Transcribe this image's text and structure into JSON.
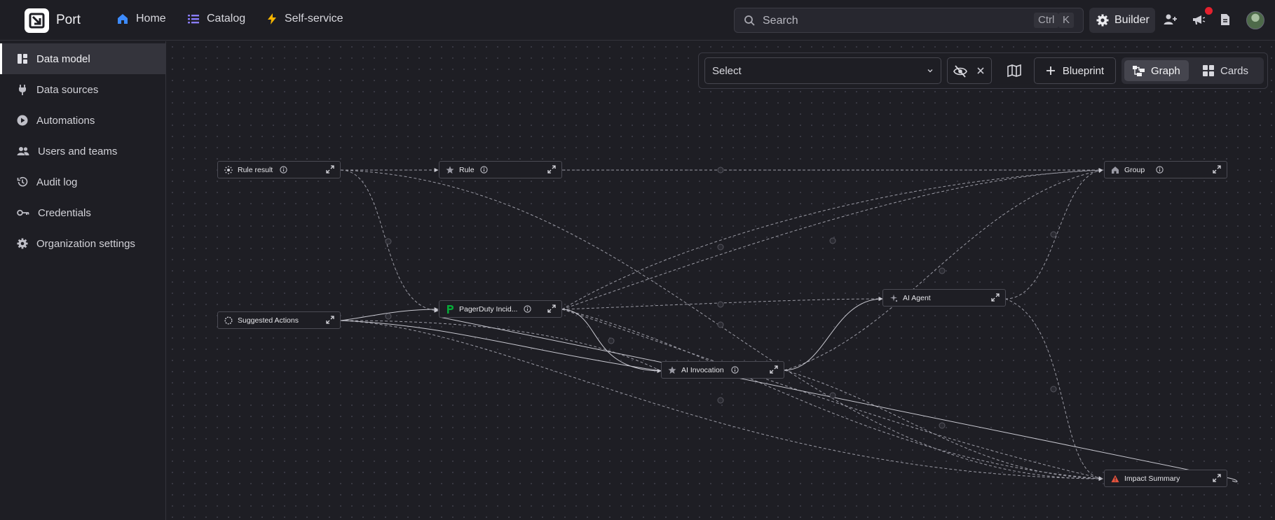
{
  "app": {
    "name": "Port"
  },
  "nav": [
    {
      "label": "Home",
      "icon": "home-icon"
    },
    {
      "label": "Catalog",
      "icon": "catalog-list-icon"
    },
    {
      "label": "Self-service",
      "icon": "lightning-icon"
    }
  ],
  "search": {
    "placeholder": "Search",
    "shortcut_ctrl": "Ctrl",
    "shortcut_key": "K"
  },
  "builder": {
    "label": "Builder"
  },
  "sidebar": [
    {
      "label": "Data model",
      "icon": "data-model-icon",
      "active": true
    },
    {
      "label": "Data sources",
      "icon": "plug-icon"
    },
    {
      "label": "Automations",
      "icon": "play-circle-icon"
    },
    {
      "label": "Users and teams",
      "icon": "users-icon"
    },
    {
      "label": "Audit log",
      "icon": "history-icon"
    },
    {
      "label": "Credentials",
      "icon": "key-icon"
    },
    {
      "label": "Organization settings",
      "icon": "gear-icon"
    }
  ],
  "toolbar": {
    "select_value": "Select",
    "blueprint_label": "Blueprint",
    "view_graph": "Graph",
    "view_cards": "Cards",
    "active_view": "Graph"
  },
  "nodes": [
    {
      "id": "rule_result",
      "label": "Rule result",
      "icon": "sun-dots-icon"
    },
    {
      "id": "rule",
      "label": "Rule",
      "icon": "star-icon"
    },
    {
      "id": "group",
      "label": "Group",
      "icon": "home-icon"
    },
    {
      "id": "suggested_actions",
      "label": "Suggested Actions",
      "icon": "dashed-circle-icon"
    },
    {
      "id": "pagerduty",
      "label": "PagerDuty Incid...",
      "icon": "pagerduty-icon"
    },
    {
      "id": "ai_agent",
      "label": "AI Agent",
      "icon": "sparkle-icon"
    },
    {
      "id": "ai_invocation",
      "label": "AI Invocation",
      "icon": "star-icon"
    },
    {
      "id": "impact_summary",
      "label": "Impact Summary",
      "icon": "warning-triangle-icon"
    }
  ],
  "colors": {
    "background": "#1e1e24",
    "pagerduty_green": "#06ac38",
    "warning_red": "#e5533d",
    "notification_red": "#e5212e",
    "home_blue": "#3d8bfd",
    "catalog_purple": "#8a7dff",
    "lightning_yellow": "#f7b500"
  }
}
